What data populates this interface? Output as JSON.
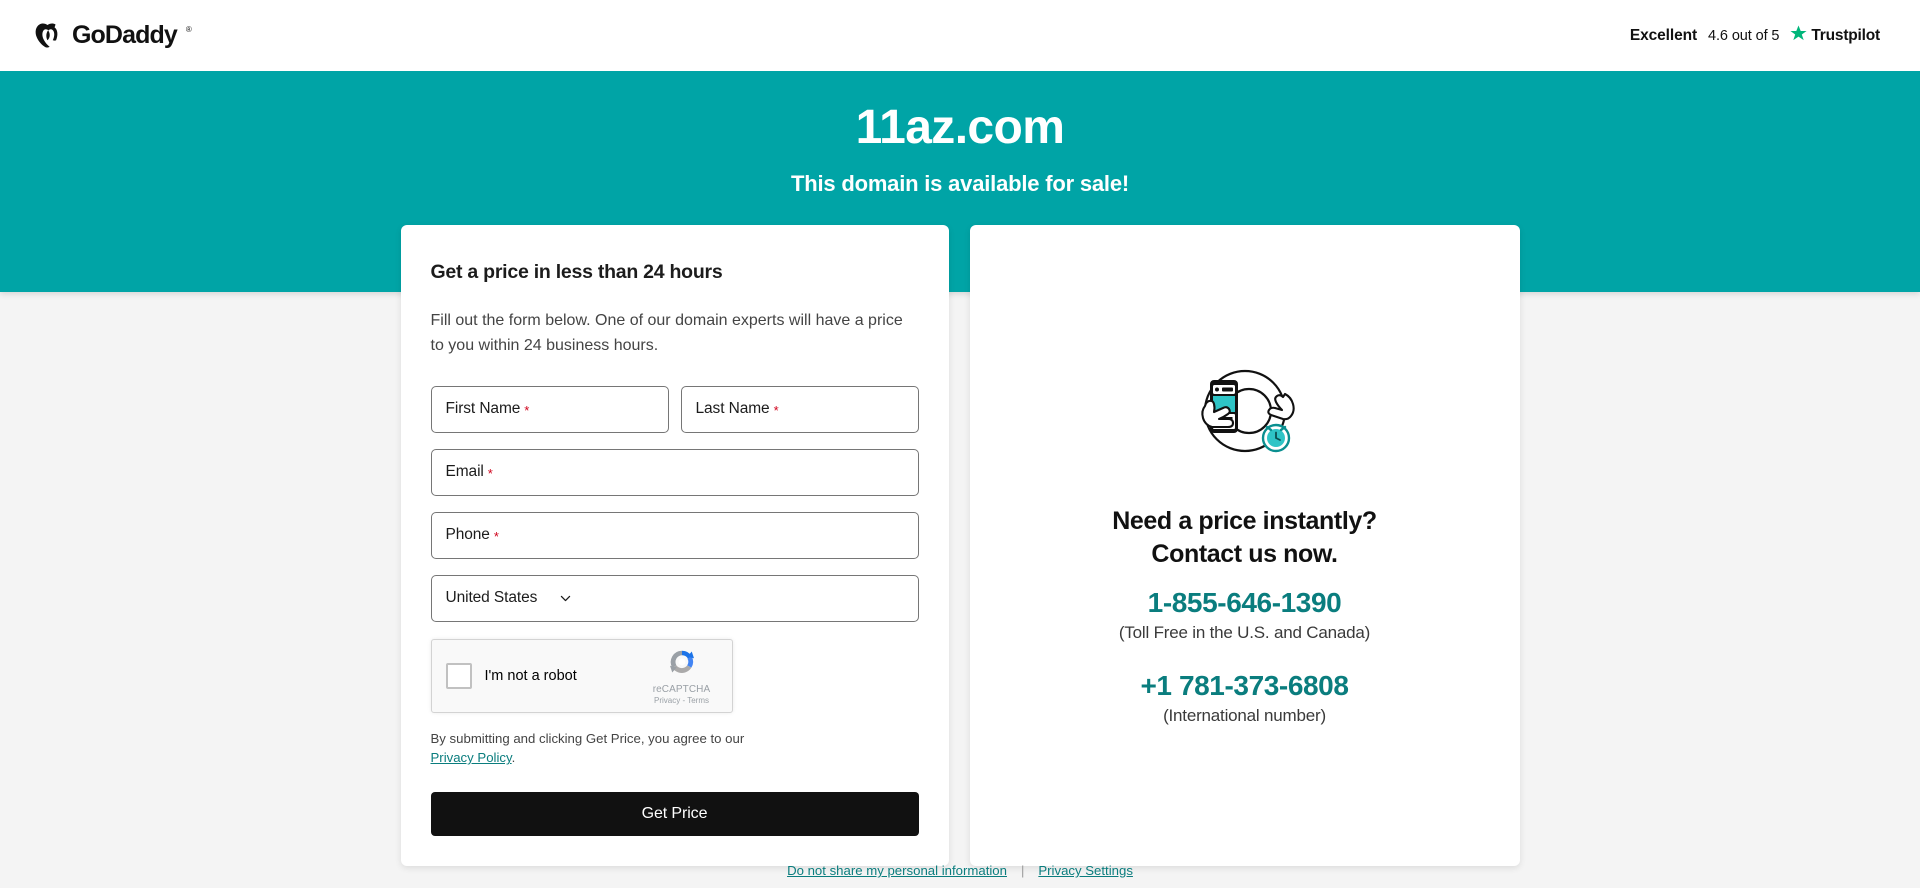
{
  "header": {
    "brand_name": "GoDaddy",
    "trustpilot": {
      "rating_word": "Excellent",
      "score_text": "4.6 out of 5",
      "brand": "Trustpilot",
      "star_color": "#00b67a"
    }
  },
  "hero": {
    "domain": "11az.com",
    "subtitle": "This domain is available for sale!",
    "background_color": "#00a4a6"
  },
  "form_card": {
    "title": "Get a price in less than 24 hours",
    "description": "Fill out the form below. One of our domain experts will have a price to you within 24 business hours.",
    "fields": {
      "first_name": {
        "label": "First Name",
        "required_mark": "*",
        "value": ""
      },
      "last_name": {
        "label": "Last Name",
        "required_mark": "*",
        "value": ""
      },
      "email": {
        "label": "Email",
        "required_mark": "*",
        "value": ""
      },
      "phone": {
        "label": "Phone",
        "required_mark": "*",
        "value": ""
      },
      "country": {
        "selected": "United States",
        "chevron": "chevron-down-icon"
      }
    },
    "recaptcha": {
      "label": "I'm not a robot",
      "brand": "reCAPTCHA",
      "links": "Privacy - Terms"
    },
    "legal": {
      "text_before": "By submitting and clicking Get Price, you agree to our ",
      "link_text": "Privacy Policy",
      "text_after": "."
    },
    "submit_label": "Get Price"
  },
  "contact_card": {
    "heading_line1": "Need a price instantly?",
    "heading_line2": "Contact us now.",
    "toll_free_number": "1-855-646-1390",
    "toll_free_note": "(Toll Free in the U.S. and Canada)",
    "international_number": "+1 781-373-6808",
    "international_note": "(International number)",
    "accent_color": "#0a7d7e"
  },
  "footer": {
    "do_not_share_link": "Do not share my personal information",
    "separator": "|",
    "privacy_settings_link": "Privacy Settings"
  }
}
